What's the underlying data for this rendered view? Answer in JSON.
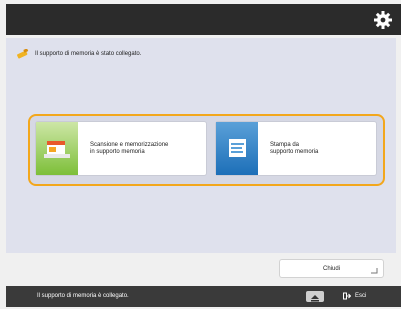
{
  "message": {
    "text": "Il supporto di memoria è stato collegato."
  },
  "options": [
    {
      "label": "Scansione e memorizzazione\nin supporto memoria"
    },
    {
      "label": "Stampa da\nsupporto memoria"
    }
  ],
  "buttons": {
    "close_label": "Chiudi"
  },
  "status": {
    "text": "Il supporto di memoria è collegato.",
    "stop_label": "Esci"
  },
  "colors": {
    "highlight": "#f3a71c",
    "top_bar": "#2b2b2b",
    "panel": "#dfe1ed"
  }
}
